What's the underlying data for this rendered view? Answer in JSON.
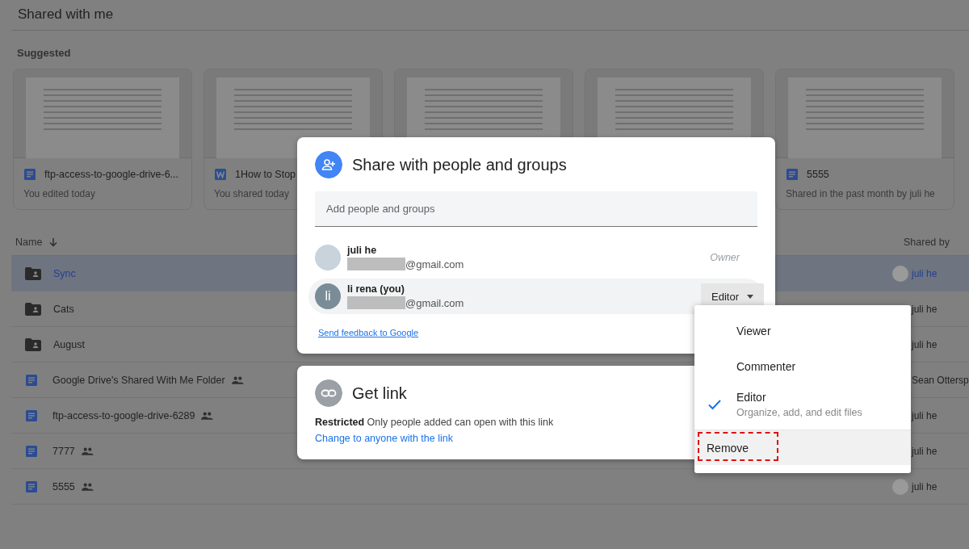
{
  "page": {
    "title": "Shared with me"
  },
  "suggested": {
    "heading": "Suggested",
    "cards": [
      {
        "kind": "doc",
        "name": "ftp-access-to-google-drive-6...",
        "subtitle": "You edited today"
      },
      {
        "kind": "word",
        "name": "1How to Stop",
        "subtitle": "You shared today"
      },
      {
        "kind": "preview"
      },
      {
        "kind": "preview"
      },
      {
        "kind": "doc",
        "name": "5555",
        "subtitle": "Shared in the past month by juli he"
      }
    ]
  },
  "list": {
    "columns": {
      "name": "Name",
      "shared_by": "Shared by"
    },
    "rows": [
      {
        "kind": "folder",
        "name": "Sync",
        "shared": false,
        "selected": true,
        "shared_by": "juli he",
        "has_avatar": true
      },
      {
        "kind": "folder",
        "name": "Cats",
        "shared": false,
        "selected": false,
        "shared_by": "juli he",
        "has_avatar": false
      },
      {
        "kind": "folder",
        "name": "August",
        "shared": false,
        "selected": false,
        "shared_by": "juli he",
        "has_avatar": false
      },
      {
        "kind": "doc",
        "name": "Google Drive's Shared With Me Folder",
        "shared": true,
        "selected": false,
        "shared_by": "Sean Ottersp",
        "has_avatar": false
      },
      {
        "kind": "doc",
        "name": "ftp-access-to-google-drive-6289",
        "shared": true,
        "selected": false,
        "shared_by": "juli he",
        "has_avatar": false
      },
      {
        "kind": "doc",
        "name": "7777",
        "shared": true,
        "selected": false,
        "shared_by": "juli he",
        "has_avatar": false
      },
      {
        "kind": "doc",
        "name": "5555",
        "shared": true,
        "selected": false,
        "shared_by": "juli he",
        "has_avatar": true
      }
    ]
  },
  "share_dialog": {
    "title": "Share with people and groups",
    "input": {
      "placeholder": "Add people and groups"
    },
    "people": [
      {
        "kind": "owner",
        "name": "juli he",
        "email": "@gmail.com",
        "role": "Owner",
        "highlighted": false
      },
      {
        "kind": "member",
        "name": "li rena (you)",
        "initials": "li",
        "email": "@gmail.com",
        "role": "Editor",
        "highlighted": true
      }
    ],
    "feedback_link": "Send feedback to Google"
  },
  "link_dialog": {
    "title": "Get link",
    "description": "**Restricted** Only people added can open with this link",
    "change_link": "Change to anyone with the link"
  },
  "role_menu": {
    "items": [
      {
        "kind": "role",
        "label": "Viewer",
        "selected": false,
        "hovered": false,
        "marked": false
      },
      {
        "kind": "role",
        "label": "Commenter",
        "selected": false,
        "hovered": false,
        "marked": false
      },
      {
        "kind": "role",
        "label": "Editor",
        "description": "Organize, add, and edit files",
        "selected": true,
        "hovered": false,
        "marked": false
      },
      {
        "kind": "action",
        "label": "Remove",
        "selected": false,
        "hovered": true,
        "marked": true
      }
    ]
  }
}
